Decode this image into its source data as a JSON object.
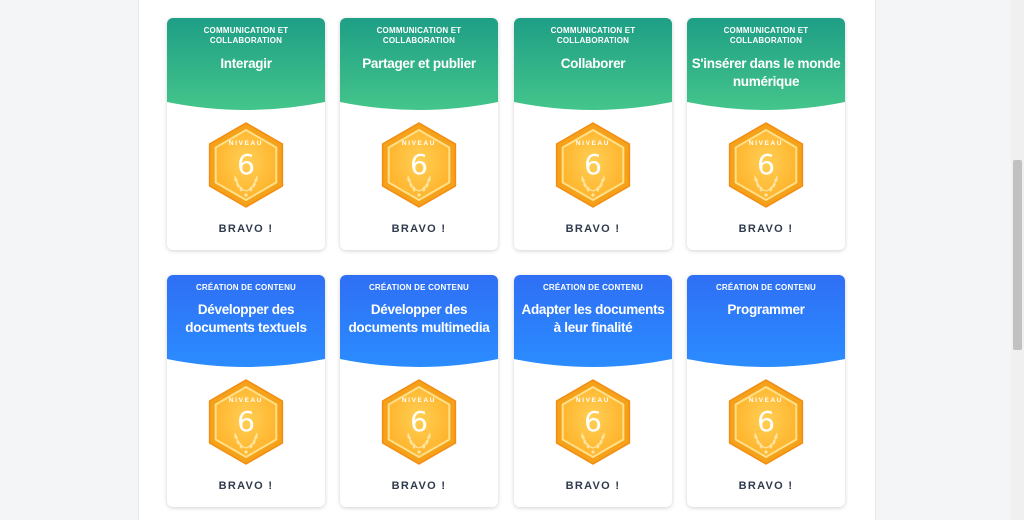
{
  "colors": {
    "green_top": "#1e9e85",
    "green_bottom": "#44c58b",
    "blue_top": "#2f6ff5",
    "blue_bottom": "#2b8cff",
    "badge_outer": "#f5a11a",
    "badge_inner": "#ffb128",
    "text_dark": "#2f3b4c"
  },
  "cards": [
    {
      "category": "COMMUNICATION ET COLLABORATION",
      "title": "Interagir",
      "level_label": "NIVEAU",
      "level": "6",
      "status": "BRAVO !",
      "theme": "green"
    },
    {
      "category": "COMMUNICATION ET COLLABORATION",
      "title": "Partager et publier",
      "level_label": "NIVEAU",
      "level": "6",
      "status": "BRAVO !",
      "theme": "green"
    },
    {
      "category": "COMMUNICATION ET COLLABORATION",
      "title": "Collaborer",
      "level_label": "NIVEAU",
      "level": "6",
      "status": "BRAVO !",
      "theme": "green"
    },
    {
      "category": "COMMUNICATION ET COLLABORATION",
      "title": "S'insérer dans le monde numérique",
      "level_label": "NIVEAU",
      "level": "6",
      "status": "BRAVO !",
      "theme": "green"
    },
    {
      "category": "CRÉATION DE CONTENU",
      "title": "Développer des documents textuels",
      "level_label": "NIVEAU",
      "level": "6",
      "status": "BRAVO !",
      "theme": "blue"
    },
    {
      "category": "CRÉATION DE CONTENU",
      "title": "Développer des documents multimedia",
      "level_label": "NIVEAU",
      "level": "6",
      "status": "BRAVO !",
      "theme": "blue"
    },
    {
      "category": "CRÉATION DE CONTENU",
      "title": "Adapter les documents à leur finalité",
      "level_label": "NIVEAU",
      "level": "6",
      "status": "BRAVO !",
      "theme": "blue"
    },
    {
      "category": "CRÉATION DE CONTENU",
      "title": "Programmer",
      "level_label": "NIVEAU",
      "level": "6",
      "status": "BRAVO !",
      "theme": "blue"
    }
  ]
}
